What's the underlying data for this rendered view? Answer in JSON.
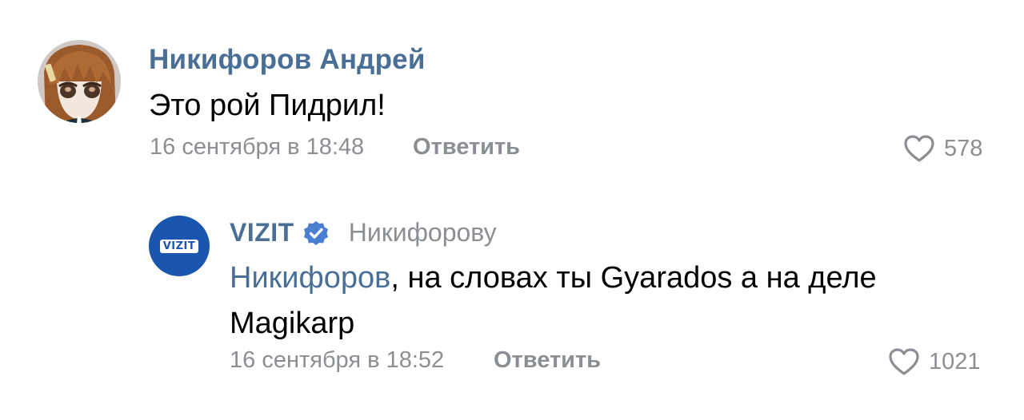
{
  "comments": [
    {
      "author": "Никифоров Андрей",
      "text": "Это рой Пидрил!",
      "date": "16 сентября в 18:48",
      "reply_label": "Ответить",
      "likes": "578",
      "avatar_icon": "anime-girl-avatar"
    },
    {
      "author": "VIZIT",
      "verified_icon": "verified-checkmark-icon",
      "reply_to": "Никифорову",
      "mention": "Никифоров",
      "text": ", на словах ты Gyarados а на деле Magikarp",
      "date": "16 сентября в 18:52",
      "reply_label": "Ответить",
      "likes": "1021",
      "avatar_label": "VIZIT",
      "avatar_icon": "vizit-logo-avatar"
    }
  ],
  "colors": {
    "link": "#4a6f97",
    "meta": "#8b8f94",
    "text": "#000000",
    "vizit_blue": "#1a56b0"
  }
}
